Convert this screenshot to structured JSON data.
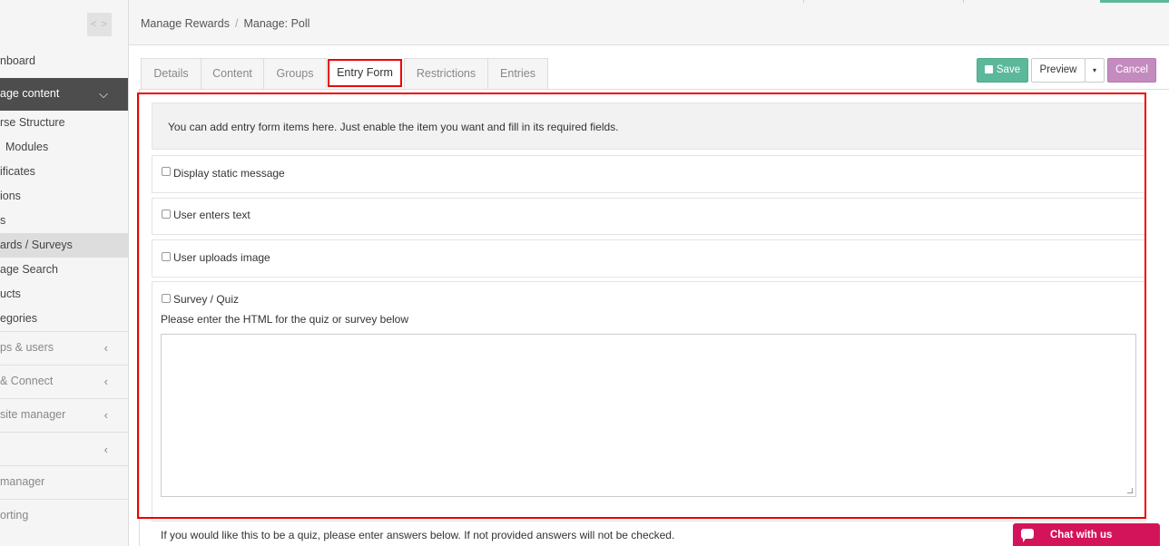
{
  "sidebar": {
    "toggle_label": "< >",
    "items": [
      {
        "label": "nboard"
      },
      {
        "label": "age content"
      },
      {
        "label": "rse Structure"
      },
      {
        "label": "Modules"
      },
      {
        "label": "ificates"
      },
      {
        "label": "ions"
      },
      {
        "label": "s"
      },
      {
        "label": "ards / Surveys"
      },
      {
        "label": "age Search"
      },
      {
        "label": "ucts"
      },
      {
        "label": "egories"
      },
      {
        "label": "ps & users"
      },
      {
        "label": "& Connect"
      },
      {
        "label": "site manager"
      },
      {
        "label": ""
      },
      {
        "label": "manager"
      },
      {
        "label": "orting"
      }
    ]
  },
  "breadcrumb": {
    "items": [
      "Manage Rewards",
      "Manage: Poll"
    ],
    "separator": "/"
  },
  "tabs": [
    "Details",
    "Content",
    "Groups",
    "Entry Form",
    "Restrictions",
    "Entries"
  ],
  "active_tab": "Entry Form",
  "actions": {
    "save": "Save",
    "preview": "Preview",
    "caret": "▾",
    "cancel": "Cancel"
  },
  "form": {
    "info": "You can add entry form items here. Just enable the item you want and fill in its required fields.",
    "options": [
      {
        "label": "Display static message",
        "checked": false
      },
      {
        "label": "User enters text",
        "checked": false
      },
      {
        "label": "User uploads image",
        "checked": false
      },
      {
        "label": "Survey / Quiz",
        "checked": false
      }
    ],
    "survey_html_label": "Please enter the HTML for the quiz or survey below",
    "survey_html_value": "",
    "quiz_note": "If you would like this to be a quiz, please enter answers below. If not provided answers will not be checked."
  },
  "chat": {
    "label": "Chat with us"
  },
  "colors": {
    "save": "#5cb89b",
    "cancel": "#c48bbf",
    "chat": "#d4145a",
    "highlight": "#ee0000",
    "sidebar_active": "#4d4d4d"
  }
}
